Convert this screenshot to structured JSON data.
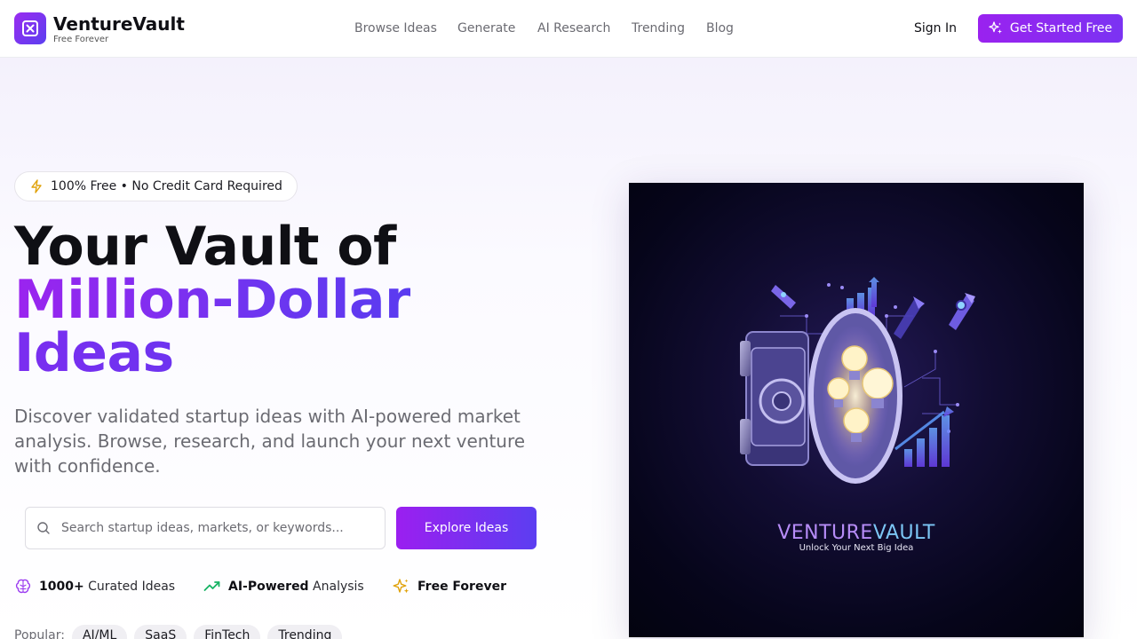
{
  "header": {
    "brand_name": "VentureVault",
    "brand_tag": "Free Forever",
    "nav": [
      "Browse Ideas",
      "Generate",
      "AI Research",
      "Trending",
      "Blog"
    ],
    "sign_in": "Sign In",
    "cta": "Get Started Free"
  },
  "hero": {
    "badge": "100% Free • No Credit Card Required",
    "title_line1": "Your Vault of",
    "title_line2": "Million-Dollar",
    "title_line3": "Ideas",
    "subtitle": "Discover validated startup ideas with AI-powered market analysis. Browse, research, and launch your next venture with confidence.",
    "search": {
      "placeholder": "Search startup ideas, markets, or keywords...",
      "value": ""
    },
    "explore_button": "Explore Ideas",
    "features": [
      {
        "bold": "1000+",
        "rest": " Curated Ideas",
        "icon": "brain-icon"
      },
      {
        "bold": "AI-Powered",
        "rest": " Analysis",
        "icon": "trending-up-icon"
      },
      {
        "bold": "Free Forever",
        "rest": "",
        "icon": "sparkles-icon"
      }
    ],
    "popular_label": "Popular:",
    "popular_tags": [
      "AI/ML",
      "SaaS",
      "FinTech",
      "Trending"
    ]
  },
  "hero_image": {
    "title_part1": "VENTURE",
    "title_part2": "VAULT",
    "tagline": "Unlock Your Next Big Idea"
  },
  "colors": {
    "accent_purple": "#9a22ef",
    "accent_indigo": "#5a3bf0",
    "text_dark": "#0f0f14",
    "text_muted": "#6b6b72"
  }
}
